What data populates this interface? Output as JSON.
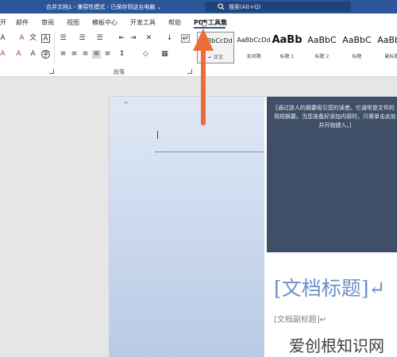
{
  "titlebar": {
    "doc_title": "合并文档1  -  兼容性模式  -  已保存到这台电脑 ⌄",
    "search_placeholder": "搜索(Alt+Q)"
  },
  "tabs": [
    {
      "label": "开"
    },
    {
      "label": "邮件"
    },
    {
      "label": "审阅"
    },
    {
      "label": "视图"
    },
    {
      "label": "模板中心"
    },
    {
      "label": "开发工具"
    },
    {
      "label": "帮助"
    },
    {
      "label": "PDF工具集"
    }
  ],
  "ribbon": {
    "group_label": "段落",
    "styles": [
      {
        "sample": "AaBbCcDd",
        "name": "↵ 正文"
      },
      {
        "sample": "AaBbCcDd",
        "name": "无间隔"
      },
      {
        "sample": "AaBb",
        "name": "标题 1"
      },
      {
        "sample": "AaBbC",
        "name": "标题 2"
      },
      {
        "sample": "AaBbC",
        "name": "标题"
      },
      {
        "sample": "AaBbC",
        "name": "副标题"
      }
    ]
  },
  "document": {
    "abstract": "[通过迷人的摘要吸引您的读者。它通常是文件的简短摘要。当您准备好添加内容时，只需单击此处并开始键入。]",
    "title_placeholder": "[文档标题]↵",
    "subtitle_placeholder": "[文档副标题]↵"
  },
  "watermark": "爱创根知识网",
  "colors": {
    "title_bar": "#2b579a",
    "cover_dark": "#3f4f68",
    "title_text": "#6a8fc7",
    "arrow": "#ee6b3a"
  }
}
